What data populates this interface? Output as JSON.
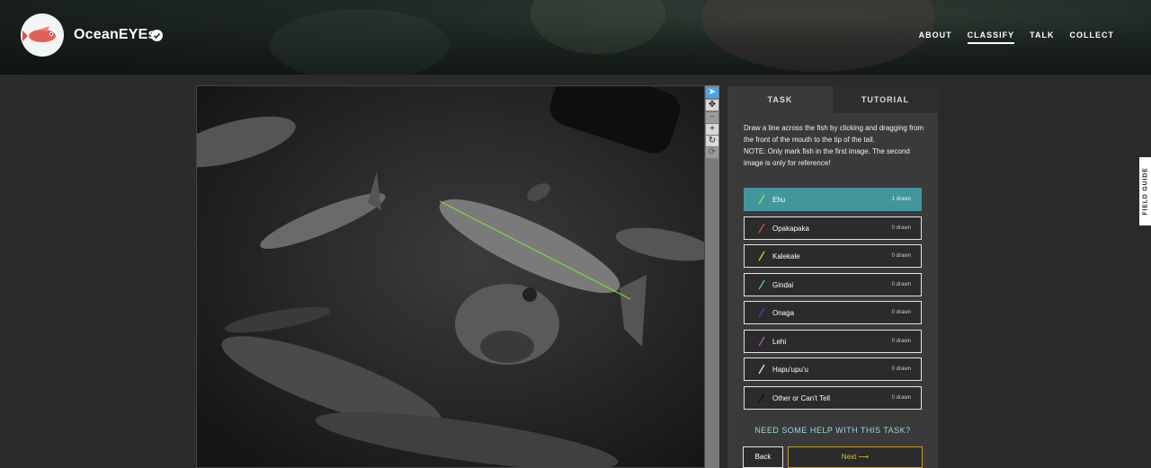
{
  "project": {
    "title": "OceanEYEs"
  },
  "nav": [
    {
      "label": "ABOUT",
      "active": false
    },
    {
      "label": "CLASSIFY",
      "active": true
    },
    {
      "label": "TALK",
      "active": false
    },
    {
      "label": "COLLECT",
      "active": false
    }
  ],
  "tools": [
    {
      "icon": "pointer-icon",
      "glyph": "➤",
      "active": true
    },
    {
      "icon": "pan-icon",
      "glyph": "✥",
      "active": false
    },
    {
      "icon": "zoom-out-icon",
      "glyph": "−",
      "active": false
    },
    {
      "icon": "zoom-in-icon",
      "glyph": "+",
      "active": false
    },
    {
      "icon": "rotate-icon",
      "glyph": "↻",
      "active": false
    },
    {
      "icon": "reset-icon",
      "glyph": "⟳",
      "active": false
    }
  ],
  "tabs": {
    "task": "TASK",
    "tutorial": "TUTORIAL"
  },
  "instructions": {
    "line1": "Draw a line across the fish by clicking and dragging from the front of the mouth to the tip of the tail.",
    "line2": "NOTE: Only mark fish in the first image. The second image is only for reference!"
  },
  "choices": [
    {
      "label": "Ehu",
      "count": "1 drawn",
      "color": "#9be06a",
      "selected": true
    },
    {
      "label": "Opakapaka",
      "count": "0 drawn",
      "color": "#e0503c",
      "selected": false
    },
    {
      "label": "Kalekale",
      "count": "0 drawn",
      "color": "#d6cf55",
      "selected": false
    },
    {
      "label": "Gindai",
      "count": "0 drawn",
      "color": "#58c0c8",
      "selected": false
    },
    {
      "label": "Onaga",
      "count": "0 drawn",
      "color": "#3b47c9",
      "selected": false
    },
    {
      "label": "Lehi",
      "count": "0 drawn",
      "color": "#c24fc2",
      "selected": false
    },
    {
      "label": "Hapu'upu'u",
      "count": "0 drawn",
      "color": "#e8e8e8",
      "selected": false
    },
    {
      "label": "Other or Can't Tell",
      "count": "0 drawn",
      "color": "#222222",
      "selected": false
    }
  ],
  "help": "NEED SOME HELP WITH THIS TASK?",
  "buttons": {
    "back": "Back",
    "next": "Next ⟶"
  },
  "field_guide": "FIELD GUIDE",
  "colors": {
    "accent": "#43979c",
    "next_border": "#c9a227",
    "help_text": "#9fd5e6",
    "mark_line": "#7ddc3c"
  }
}
